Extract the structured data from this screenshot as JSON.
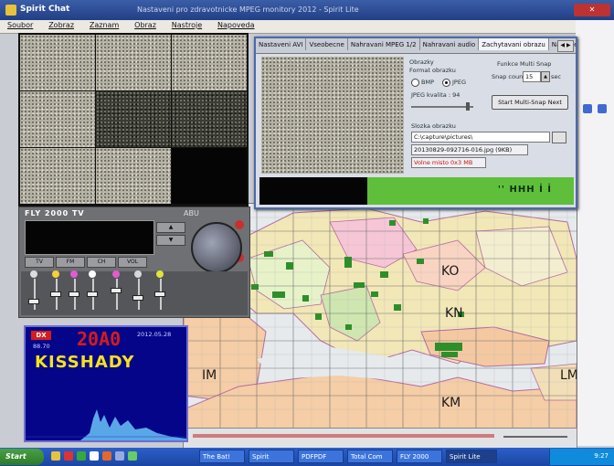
{
  "window": {
    "title": "Spirit Chat",
    "subtitle": "Nastaveni pro zdravotnicke MPEG monitory 2012 - Spirit Lite"
  },
  "menu": [
    "Soubor",
    "Zobraz",
    "Zaznam",
    "Obraz",
    "Nastroje",
    "Napoveda"
  ],
  "dialog": {
    "tabs": [
      "Nastaveni AVI",
      "Vseobecne",
      "Nahravani MPEG 1/2",
      "Nahravani audio",
      "Zachytavani obrazu",
      "Nastaveni"
    ],
    "active_tab": 4,
    "format_group": "Format obrazku",
    "format_section": "Obrazky",
    "radio_bmp": "BMP",
    "radio_jpeg": "JPEG",
    "quality_label": "JPEG kvalita : 94",
    "multisnap_title": "Funkce Multi Snap",
    "snap_count_label": "Snap count",
    "snap_count_value": "15",
    "snap_unit": "sec",
    "start_multisnap_button": "Start Multi-Snap Next",
    "folder_label": "Slozka obrazku",
    "folder_value": "C:\\capture\\pictures\\",
    "filename_value": "20130829-092716-016.jpg (9KB)",
    "warning_value": "Volne misto 0x3 MB",
    "greenbar_text": "'' HHH  İ İ"
  },
  "player": {
    "title": "FLY 2000 TV",
    "brand": "ABU",
    "buttons": [
      "TV",
      "FM",
      "CH",
      "VOL"
    ]
  },
  "dx": {
    "icon": "DX",
    "callsign": "20A0",
    "date": "2012.05.28",
    "freq": "88.70",
    "name": "KISSHADY"
  },
  "map": {
    "labels": [
      "KO",
      "KN",
      "IM",
      "KM",
      "LM"
    ]
  },
  "taskbar": {
    "start": "Start",
    "items": [
      "The Bat!",
      "Spirit",
      "PDFPDF",
      "Total Com",
      "FLY 2000",
      "Spirit Lite"
    ],
    "active_index": 5,
    "clock": "9:27"
  },
  "colors": {
    "dx_background": "#05058a",
    "dx_callsign": "#d31c1c",
    "dx_name": "#f5e21c",
    "greenbar": "#5fbf3a",
    "title_bar": "#223f86"
  }
}
